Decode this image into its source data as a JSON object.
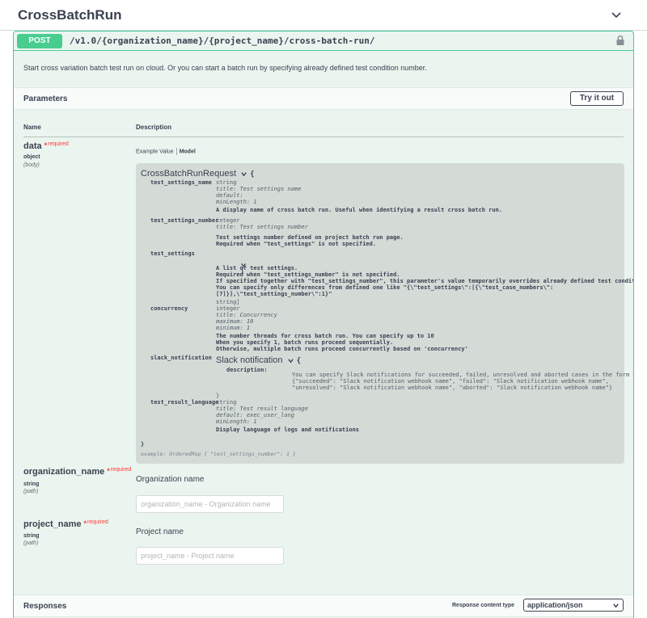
{
  "tag": {
    "title": "CrossBatchRun",
    "collapse_icon": "chevron-down-icon"
  },
  "operation": {
    "method": "POST",
    "path": "/v1.0/{organization_name}/{project_name}/cross-batch-run/",
    "lock_icon": "lock-icon",
    "description": "Start cross variation batch test run on cloud. Or you can start a batch run by specifying already defined test condition number.",
    "accent_color": "#49cc90"
  },
  "parameters": {
    "heading": "Parameters",
    "try_button": "Try it out",
    "col_name": "Name",
    "col_description": "Description"
  },
  "param_data": {
    "name": "data",
    "required_star": "*",
    "required": "required",
    "type": "object",
    "in": "(body)",
    "tab_example": "Example Value",
    "tab_model": "Model"
  },
  "model": {
    "title": "CrossBatchRunRequest",
    "open_brace": "{",
    "close_brace": "}",
    "props": {
      "test_settings_name": {
        "name": "test_settings_name",
        "type": "string",
        "meta": "title: Test settings name\ndefault:\nminLength: 1",
        "desc": "A display name of cross batch run. Useful when identifying a result cross batch run."
      },
      "test_settings_number": {
        "name": "test_settings_number",
        "type": "integer",
        "meta": "title: Test settings number",
        "desc": "Test settings number defined on project batch run page.\nRequired when \"test_settings\" is not specified."
      },
      "test_settings": {
        "name": "test_settings",
        "open": "[",
        "desc": "A list of test settings.\nRequired when \"test_settings_number\" is not specified.\nIf specified together with \"test_settings_number\", this parameter's value temporarily overrides already defined test condition.\nYou can specify only differences from defined one like \"{\\\"test_settings\\\":[{\\\"test_case_numbers\\\":\n[7]}],\\\"test_settings_number\\\":1}\"",
        "tail": "string]"
      },
      "concurrency": {
        "name": "concurrency",
        "type": "integer",
        "meta": "title: Concurrency\nmaximum: 10\nminimum: 1",
        "desc": "The number threads for cross batch run. You can specify up to 10\nWhen you specify 1, batch runs proceed sequentially.\nOtherwise, multiple batch runs proceed concurrently based on 'concurrency'"
      },
      "slack_notification": {
        "name": "slack_notification",
        "sub_title": "Slack notification",
        "open": "{",
        "sub_prop": "description:",
        "sub_desc": "You can specify Slack notifications for succeeded, failed, unresolved and aborted cases in the form of\n{\"succeeded\": \"Slack notification webhook name\", \"failed\": \"Slack notification webhook name\",\n\"unresolved\": \"Slack notification webhook name\", \"aborted\": \"Slack notification webhook name\"}",
        "close": "}"
      },
      "test_result_language": {
        "name": "test_result_language",
        "type": "string",
        "meta": "title: Test result language\ndefault: exec_user_lang\nminLength: 1",
        "desc": "Display language of logs and notifications"
      }
    },
    "example": "example: OrderedMap { \"test_settings_number\": 1 }"
  },
  "param_org": {
    "name": "organization_name",
    "required_star": "*",
    "required": "required",
    "type": "string",
    "in": "(path)",
    "label": "Organization name",
    "placeholder": "organization_name - Organization name"
  },
  "param_proj": {
    "name": "project_name",
    "required_star": "*",
    "required": "required",
    "type": "string",
    "in": "(path)",
    "label": "Project name",
    "placeholder": "project_name - Project name"
  },
  "responses": {
    "heading": "Responses",
    "content_type_label": "Response content type",
    "content_type": "application/json"
  }
}
